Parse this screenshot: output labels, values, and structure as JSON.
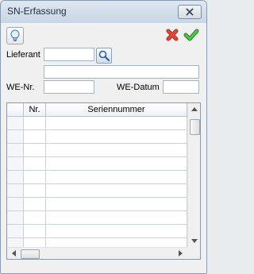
{
  "window": {
    "title": "SN-Erfassung"
  },
  "toolbar": {
    "hint_icon": "lightbulb-icon",
    "cancel_icon": "red-x-icon",
    "ok_icon": "green-check-icon"
  },
  "form": {
    "lieferant_label": "Lieferant",
    "lieferant_value": "",
    "lieferant_name_value": "",
    "we_nr_label": "WE-Nr.",
    "we_nr_value": "",
    "we_datum_label": "WE-Datum",
    "we_datum_value": ""
  },
  "grid": {
    "columns": [
      "",
      "Nr.",
      "Seriennummer"
    ],
    "rows": [
      [
        "",
        "",
        ""
      ],
      [
        "",
        "",
        ""
      ],
      [
        "",
        "",
        ""
      ],
      [
        "",
        "",
        ""
      ],
      [
        "",
        "",
        ""
      ],
      [
        "",
        "",
        ""
      ],
      [
        "",
        "",
        ""
      ],
      [
        "",
        "",
        ""
      ],
      [
        "",
        "",
        ""
      ],
      [
        "",
        "",
        ""
      ]
    ]
  },
  "colors": {
    "title_bar": "#c9d6e6",
    "cancel": "#d83a2e",
    "ok": "#3aa83a"
  }
}
